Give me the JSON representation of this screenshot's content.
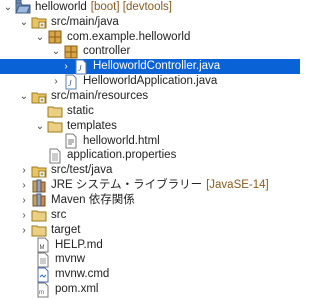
{
  "tree": {
    "project": {
      "name": "helloworld",
      "decoration": "[boot] [devtools]"
    },
    "items": [
      {
        "label": "src/main/java",
        "icon": "source-folder-icon"
      },
      {
        "label": "com.example.helloworld",
        "icon": "package-icon"
      },
      {
        "label": "controller",
        "icon": "package-icon"
      },
      {
        "label": "HelloworldController.java",
        "icon": "java-file-icon",
        "selected": true
      },
      {
        "label": "HelloworldApplication.java",
        "icon": "java-file-icon"
      },
      {
        "label": "src/main/resources",
        "icon": "source-folder-icon"
      },
      {
        "label": "static",
        "icon": "folder-icon"
      },
      {
        "label": "templates",
        "icon": "folder-icon"
      },
      {
        "label": "helloworld.html",
        "icon": "html-file-icon"
      },
      {
        "label": "application.properties",
        "icon": "properties-file-icon"
      },
      {
        "label": "src/test/java",
        "icon": "source-folder-icon"
      },
      {
        "label": "JRE システム・ライブラリー",
        "decoration": "[JavaSE-14]",
        "icon": "library-icon"
      },
      {
        "label": "Maven 依存関係",
        "icon": "library-icon"
      },
      {
        "label": "src",
        "icon": "folder-icon"
      },
      {
        "label": "target",
        "icon": "folder-icon"
      },
      {
        "label": "HELP.md",
        "icon": "markdown-file-icon"
      },
      {
        "label": "mvnw",
        "icon": "text-file-icon"
      },
      {
        "label": "mvnw.cmd",
        "icon": "cmd-file-icon"
      },
      {
        "label": "pom.xml",
        "icon": "xml-file-icon"
      }
    ]
  },
  "colors": {
    "selection": "#0a63d6",
    "decoration": "#8b5a1e"
  }
}
